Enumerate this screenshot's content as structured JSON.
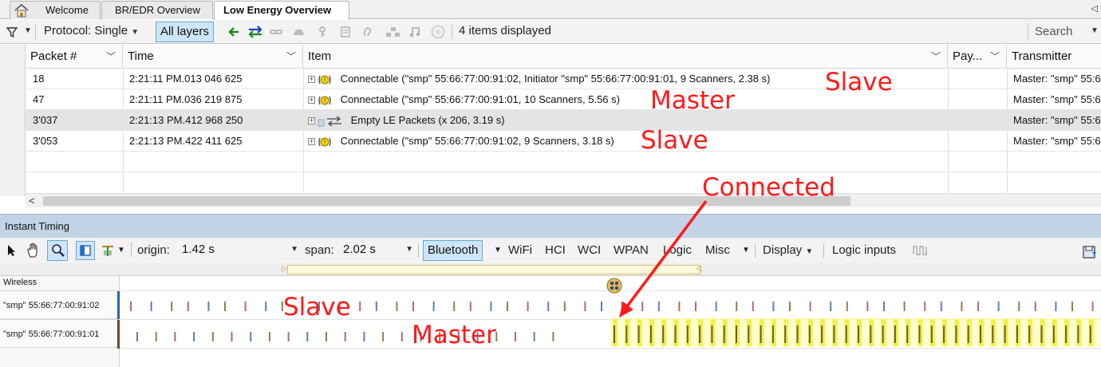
{
  "tabs": [
    {
      "label": "Welcome",
      "active": false
    },
    {
      "label": "BR/EDR Overview",
      "active": false
    },
    {
      "label": "Low Energy Overview",
      "active": true
    }
  ],
  "filter_toolbar": {
    "protocol_label": "Protocol: Single",
    "all_layers_label": "All layers",
    "items_displayed": "4 items displayed",
    "search_placeholder": "Search"
  },
  "table": {
    "columns": [
      "Packet #",
      "Time",
      "Item",
      "Pay...",
      "Transmitter"
    ],
    "rows": [
      {
        "packet": "18",
        "time": "2:21:11 PM.013 046 625",
        "item": "Connectable (\"smp\" 55:66:77:00:91:02, Initiator \"smp\" 55:66:77:00:91:01, 9 Scanners, 2.38 s)",
        "transmitter": "Master: \"smp\" 55:6",
        "selected": false
      },
      {
        "packet": "47",
        "time": "2:21:11 PM.036 219 875",
        "item": "Connectable (\"smp\" 55:66:77:00:91:01, 10 Scanners, 5.56 s)",
        "transmitter": "Master: \"smp\" 55:6",
        "selected": false
      },
      {
        "packet": "3'037",
        "time": "2:21:13 PM.412 968 250",
        "item": "Empty LE Packets (x 206, 3.19 s)",
        "transmitter": "Master: \"smp\" 55:6",
        "selected": true
      },
      {
        "packet": "3'053",
        "time": "2:21:13 PM.422 411 625",
        "item": "Connectable (\"smp\" 55:66:77:00:91:02, 9 Scanners, 3.18 s)",
        "transmitter": "Master: \"smp\" 55:6",
        "selected": false
      }
    ]
  },
  "timing_panel": {
    "title": "Instant Timing",
    "origin_label": "origin:",
    "origin_value": "1.42 s",
    "span_label": "span:",
    "span_value": "2.02 s",
    "bluetooth_label": "Bluetooth",
    "menu_items": [
      "WiFi",
      "HCI",
      "WCI",
      "WPAN",
      "Logic",
      "Misc"
    ],
    "display_label": "Display",
    "logic_inputs_label": "Logic inputs",
    "lanes": {
      "group_label": "Wireless",
      "device1": "\"smp\" 55:66:77:00:91:02",
      "device2": "\"smp\" 55:66:77:00:91:01"
    }
  },
  "annotations": {
    "row1_note": "Slave",
    "row2_note": "Master",
    "row4_note": "Slave",
    "connected": "Connected",
    "lane1_note": "Slave",
    "lane2_note": "Master"
  },
  "colors": {
    "annotation": "#ff1a1a",
    "panel_header": "#c3d3e6",
    "selected_button": "#cde6f7",
    "connection_highlight": "#ffff66"
  }
}
